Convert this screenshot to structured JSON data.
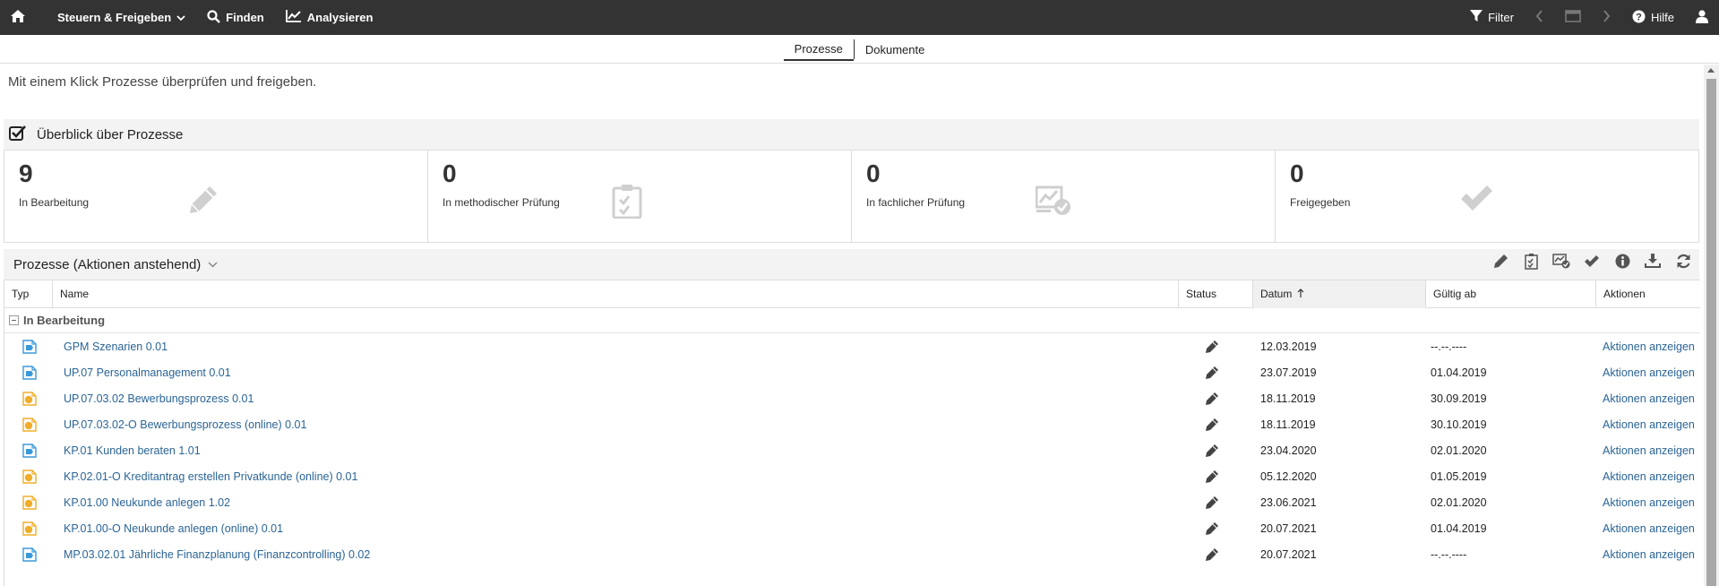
{
  "topbar": {
    "menu_label": "Steuern & Freigeben",
    "find_label": "Finden",
    "analyze_label": "Analysieren",
    "filter_label": "Filter",
    "help_label": "Hilfe"
  },
  "subtabs": {
    "processes": "Prozesse",
    "documents": "Dokumente"
  },
  "intro_text": "Mit einem Klick Prozesse überprüfen und freigeben.",
  "overview": {
    "title": "Überblick über Prozesse",
    "stats": [
      {
        "count": "9",
        "label": "In Bearbeitung",
        "icon": "pencil-icon"
      },
      {
        "count": "0",
        "label": "In methodischer Prüfung",
        "icon": "clipboard-check-icon"
      },
      {
        "count": "0",
        "label": "In fachlicher Prüfung",
        "icon": "chart-check-icon"
      },
      {
        "count": "0",
        "label": "Freigegeben",
        "icon": "checkmark-icon"
      }
    ]
  },
  "list": {
    "title": "Prozesse (Aktionen anstehend)",
    "columns": {
      "typ": "Typ",
      "name": "Name",
      "status": "Status",
      "datum": "Datum",
      "gueltig": "Gültig ab",
      "aktionen": "Aktionen"
    },
    "group_label": "In Bearbeitung",
    "rows": [
      {
        "type": "blue",
        "name": "GPM Szenarien 0.01",
        "datum": "12.03.2019",
        "gueltig": "--.--.----",
        "action": "Aktionen anzeigen"
      },
      {
        "type": "blue",
        "name": "UP.07 Personalmanagement 0.01",
        "datum": "23.07.2019",
        "gueltig": "01.04.2019",
        "action": "Aktionen anzeigen"
      },
      {
        "type": "orange",
        "name": "UP.07.03.02 Bewerbungsprozess 0.01",
        "datum": "18.11.2019",
        "gueltig": "30.09.2019",
        "action": "Aktionen anzeigen"
      },
      {
        "type": "orange",
        "name": "UP.07.03.02-O Bewerbungsprozess (online) 0.01",
        "datum": "18.11.2019",
        "gueltig": "30.10.2019",
        "action": "Aktionen anzeigen"
      },
      {
        "type": "blue",
        "name": "KP.01 Kunden beraten 1.01",
        "datum": "23.04.2020",
        "gueltig": "02.01.2020",
        "action": "Aktionen anzeigen"
      },
      {
        "type": "orange",
        "name": "KP.02.01-O Kreditantrag erstellen Privatkunde (online) 0.01",
        "datum": "05.12.2020",
        "gueltig": "01.05.2019",
        "action": "Aktionen anzeigen"
      },
      {
        "type": "orange",
        "name": "KP.01.00 Neukunde anlegen 1.02",
        "datum": "23.06.2021",
        "gueltig": "02.01.2020",
        "action": "Aktionen anzeigen"
      },
      {
        "type": "orange",
        "name": "KP.01.00-O Neukunde anlegen (online) 0.01",
        "datum": "20.07.2021",
        "gueltig": "01.04.2019",
        "action": "Aktionen anzeigen"
      },
      {
        "type": "blue",
        "name": "MP.03.02.01 Jährliche Finanzplanung (Finanzcontrolling) 0.02",
        "datum": "20.07.2021",
        "gueltig": "--.--.----",
        "action": "Aktionen anzeigen"
      }
    ]
  },
  "colors": {
    "topbar": "#333333",
    "link": "#2a6496",
    "type_blue": "#3a9ad9",
    "type_orange": "#f0ad28",
    "stat_icon": "#cfcfcf"
  }
}
